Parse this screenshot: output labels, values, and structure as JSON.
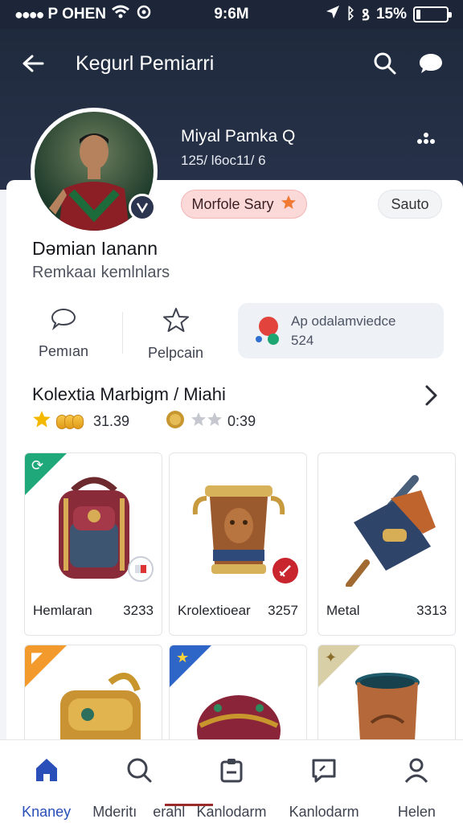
{
  "status_bar": {
    "carrier": "P OHEN",
    "time": "9:6M",
    "battery": "15%",
    "battery_level": 0.15
  },
  "app_bar": {
    "title": "Kegurl Pemiarri"
  },
  "user": {
    "name": "Miyal Pamka Q",
    "sub": "125/ l6oc11/ 6"
  },
  "badges": {
    "primary": "Morfole Sary",
    "secondary": "Sauto"
  },
  "profile": {
    "name": "Dəmian Ianann",
    "subtitle": "Remkaaı kemlnlars"
  },
  "stats": [
    {
      "label": "Pemıan",
      "icon": "chat-bubble-icon"
    },
    {
      "label": "Pelpcain",
      "icon": "star-outline-icon"
    }
  ],
  "achievement": {
    "line1": "Ap odalamviedce",
    "line2": "524"
  },
  "collection": {
    "title": "Kolextia Marbigm / Miahi",
    "rating_left": "31.39",
    "rating_right": "0:39",
    "items": [
      {
        "name": "Hemlaran",
        "price": "3233"
      },
      {
        "name": "Krolextioear",
        "price": "3257"
      },
      {
        "name": "Metal",
        "price": "3313"
      },
      {
        "name": "",
        "price": ""
      },
      {
        "name": "",
        "price": ""
      },
      {
        "name": "",
        "price": ""
      }
    ]
  },
  "bottom_nav": [
    {
      "label": "Knaney",
      "icon": "home-icon"
    },
    {
      "label": "Mderitı    erahl",
      "icon": "search-icon"
    },
    {
      "label": "Kanlodarm",
      "icon": "clipboard-icon"
    },
    {
      "label": "Kanlodarm",
      "icon": "message-icon"
    },
    {
      "label": "Helen",
      "icon": "profile-icon"
    }
  ],
  "colors": {
    "header_bg": "#1f2a3d",
    "accent_blue": "#2a4fb8",
    "badge_pink": "#fbd9d9",
    "star_orange": "#f07a33"
  }
}
